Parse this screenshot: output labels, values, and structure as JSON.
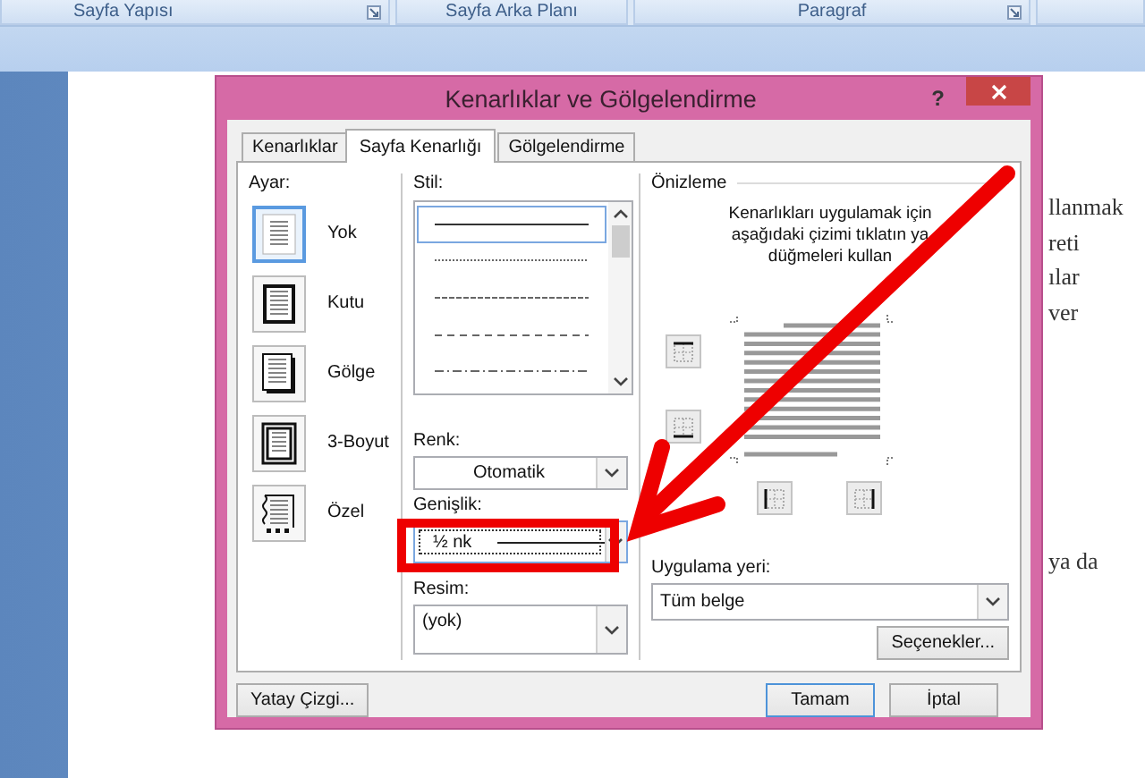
{
  "ribbon": {
    "groups": [
      {
        "label": "Sayfa Yapısı",
        "launcher": true
      },
      {
        "label": "Sayfa Arka Planı",
        "launcher": false
      },
      {
        "label": "Paragraf",
        "launcher": true
      }
    ]
  },
  "document": {
    "text_fragments": [
      "llanmak",
      "reti",
      "ılar",
      "ver",
      "ya da"
    ]
  },
  "dialog": {
    "title": "Kenarlıklar ve Gölgelendirme",
    "help": "?",
    "tabs": [
      {
        "label": "Kenarlıklar",
        "selected": false
      },
      {
        "label": "Sayfa Kenarlığı",
        "selected": true
      },
      {
        "label": "Gölgelendirme",
        "selected": false
      }
    ],
    "setting": {
      "label": "Ayar:",
      "options": [
        {
          "label": "Yok",
          "kind": "none",
          "selected": true
        },
        {
          "label": "Kutu",
          "kind": "box",
          "selected": false
        },
        {
          "label": "Gölge",
          "kind": "shadow",
          "selected": false
        },
        {
          "label": "3-Boyut",
          "kind": "three-d",
          "selected": false
        },
        {
          "label": "Özel",
          "kind": "custom",
          "selected": false
        }
      ]
    },
    "style": {
      "label": "Stil:",
      "options": [
        {
          "kind": "solid",
          "selected": true
        },
        {
          "kind": "dotted",
          "selected": false
        },
        {
          "kind": "fine-dashed",
          "selected": false
        },
        {
          "kind": "dashed",
          "selected": false
        },
        {
          "kind": "dash-dot",
          "selected": false
        }
      ]
    },
    "color": {
      "label": "Renk:",
      "value": "Otomatik"
    },
    "width": {
      "label": "Genişlik:",
      "value": "½ nk"
    },
    "art": {
      "label": "Resim:",
      "value": "(yok)"
    },
    "preview": {
      "label": "Önizleme",
      "hint_lines": [
        "Kenarlıkları uygulamak için",
        "aşağıdaki çizimi tıklatın ya",
        "düğmeleri kullan"
      ]
    },
    "apply_to": {
      "label": "Uygulama yeri:",
      "value": "Tüm belge"
    },
    "options_button": "Seçenekler...",
    "horizontal_line_button": "Yatay Çizgi...",
    "ok_button": "Tamam",
    "cancel_button": "İptal"
  }
}
